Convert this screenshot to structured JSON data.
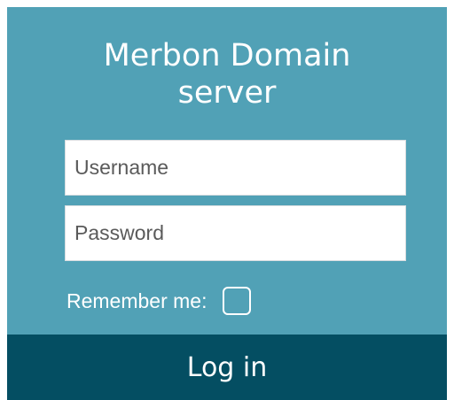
{
  "login": {
    "title_line1": "Merbon Domain",
    "title_line2": "server",
    "username_placeholder": "Username",
    "password_placeholder": "Password",
    "remember_label": "Remember me:",
    "remember_checked": false,
    "login_label": "Log in"
  },
  "colors": {
    "panel": "#51a1b6",
    "button": "#044e62",
    "text": "#ffffff"
  }
}
